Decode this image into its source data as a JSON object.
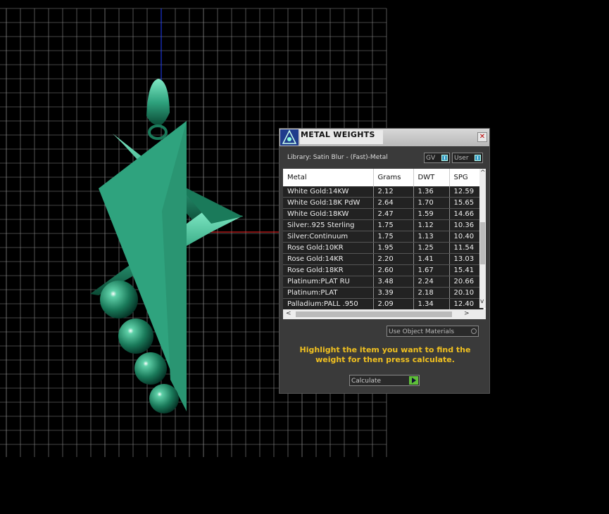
{
  "dialog": {
    "title": "METAL WEIGHTS",
    "close_label": "✕",
    "library": "Library: Satin Blur - (Fast)-Metal",
    "toggle_gv": "GV",
    "toggle_user": "User",
    "table": {
      "columns": [
        "Metal",
        "Grams",
        "DWT",
        "SPG"
      ],
      "rows": [
        [
          "White Gold:14KW",
          "2.12",
          "1.36",
          "12.59"
        ],
        [
          "White Gold:18K PdW",
          "2.64",
          "1.70",
          "15.65"
        ],
        [
          "White Gold:18KW",
          "2.47",
          "1.59",
          "14.66"
        ],
        [
          "Silver:.925 Sterling",
          "1.75",
          "1.12",
          "10.36"
        ],
        [
          "Silver:Continuum",
          "1.75",
          "1.13",
          "10.40"
        ],
        [
          "Rose Gold:10KR",
          "1.95",
          "1.25",
          "11.54"
        ],
        [
          "Rose Gold:14KR",
          "2.20",
          "1.41",
          "13.03"
        ],
        [
          "Rose Gold:18KR",
          "2.60",
          "1.67",
          "15.41"
        ],
        [
          "Platinum:PLAT RU",
          "3.48",
          "2.24",
          "20.66"
        ],
        [
          "Platinum:PLAT",
          "3.39",
          "2.18",
          "20.10"
        ],
        [
          "Palladium:PALL .950",
          "2.09",
          "1.34",
          "12.40"
        ]
      ]
    },
    "use_object_materials": "Use Object Materials",
    "hint": "Highlight the item you want to find the weight for then press calculate.",
    "calculate": "Calculate"
  },
  "colors": {
    "accent_hint": "#f0c020",
    "model_green": "#2fa37e",
    "grid": "#8a8a8a"
  }
}
